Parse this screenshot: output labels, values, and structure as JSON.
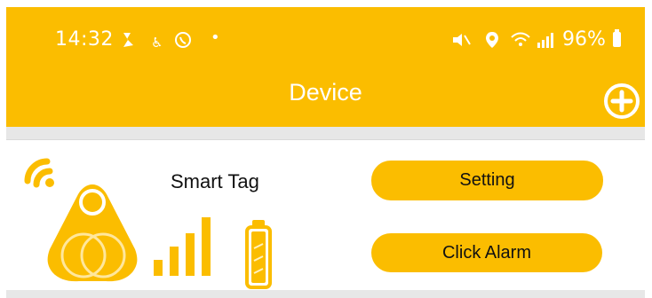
{
  "status_bar": {
    "time": "14:32",
    "battery": "96%",
    "icons": [
      "bluetooth-like-icon",
      "accessibility-icon",
      "whatsapp-icon",
      "dot-icon",
      "mute-icon",
      "location-icon",
      "wifi-icon",
      "signal-icon",
      "battery-icon"
    ]
  },
  "header": {
    "title": "Device",
    "add_icon": "plus-circle-icon"
  },
  "device_card": {
    "name": "Smart Tag",
    "setting_label": "Setting",
    "alarm_label": "Click Alarm",
    "icons": [
      "connection-icon",
      "tag-icon",
      "signal-strength-icon",
      "battery-level-icon"
    ]
  },
  "colors": {
    "accent": "#fbbd00",
    "background": "#e7e7e7",
    "text": "#111111"
  }
}
